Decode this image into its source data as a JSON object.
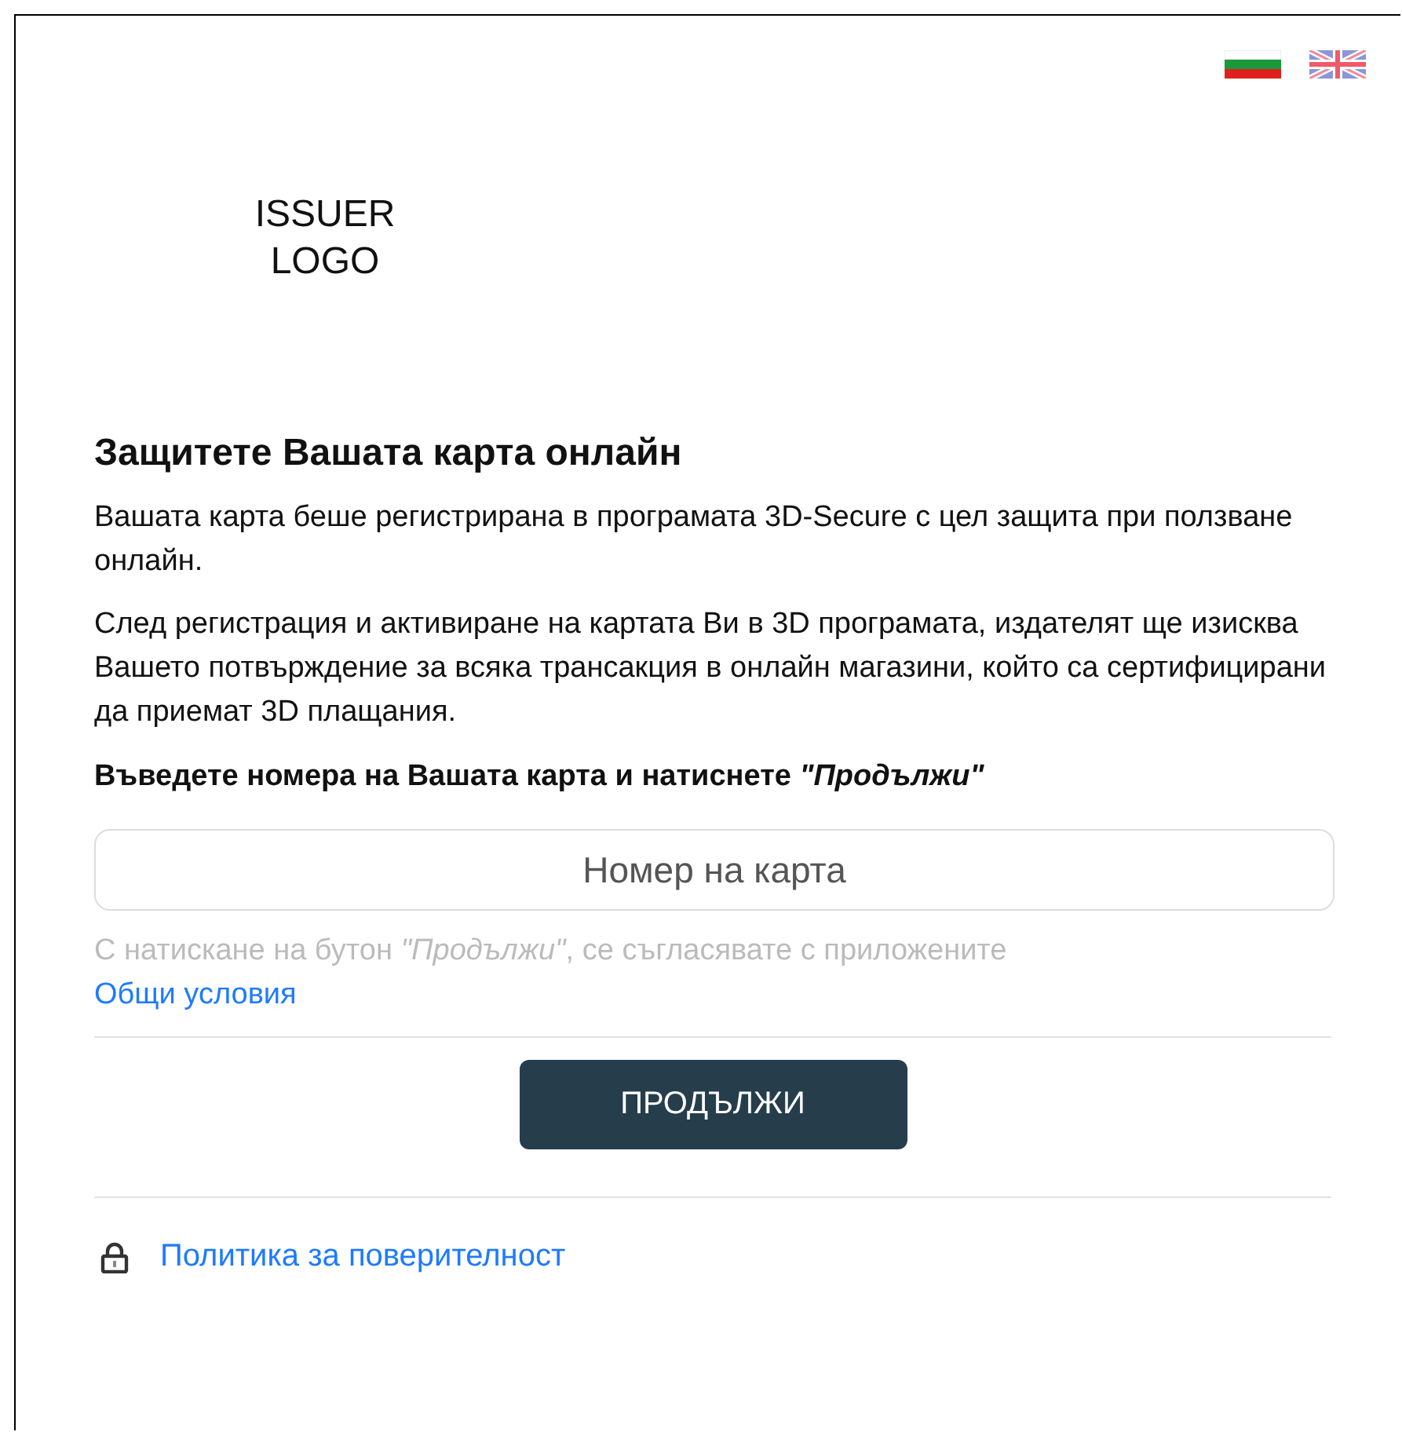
{
  "languages": [
    {
      "kind": "bg",
      "selected": false
    },
    {
      "kind": "en",
      "selected": false
    }
  ],
  "logo": "ISSUER LOGO",
  "title": "Защитете Вашата карта онлайн",
  "paragraphs": [
    "Вашата карта беше регистрирана в програмата 3D-Secure с цел защита при ползване онлайн.",
    "След регистрация и активиране на картата Ви в 3D програмата, издателят ще изисква Вашето потвърждение за всяка трансакция в онлайн магазини, който са сертифицирани да приемат 3D плащания."
  ],
  "instruction": "Въведете номера на Вашата карта и натиснете *\"Продължи\"*",
  "card_field": {
    "placeholder": "Номер на карта"
  },
  "consent": {
    "text": "С натискане на бутон *\"Продължи\"*, се съгласявате с приложените ",
    "link": "Общи условия"
  },
  "continue_button": "ПРОДЪЛЖИ",
  "privacy_link": "Политика за поверителност"
}
